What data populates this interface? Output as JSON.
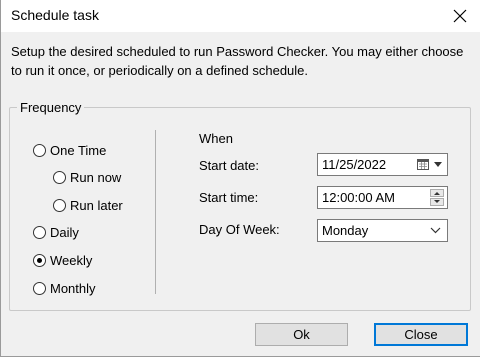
{
  "window": {
    "title": "Schedule task"
  },
  "description": "Setup the desired scheduled to run Password Checker. You may either choose to run it once, or periodically on a defined schedule.",
  "frequency": {
    "legend": "Frequency",
    "options": [
      {
        "label": "One Time",
        "checked": false
      },
      {
        "label": "Run now",
        "checked": false
      },
      {
        "label": "Run later",
        "checked": false
      },
      {
        "label": "Daily",
        "checked": false
      },
      {
        "label": "Weekly",
        "checked": true
      },
      {
        "label": "Monthly",
        "checked": false
      }
    ]
  },
  "when": {
    "heading": "When",
    "start_date_label": "Start date:",
    "start_date_value": "11/25/2022",
    "start_time_label": "Start time:",
    "start_time_value": "12:00:00 AM",
    "day_of_week_label": "Day Of Week:",
    "day_of_week_value": "Monday"
  },
  "buttons": {
    "ok": "Ok",
    "close": "Close"
  },
  "icons": {
    "close": "close-icon",
    "calendar": "calendar-icon",
    "dropdown": "chevron-down-icon"
  }
}
